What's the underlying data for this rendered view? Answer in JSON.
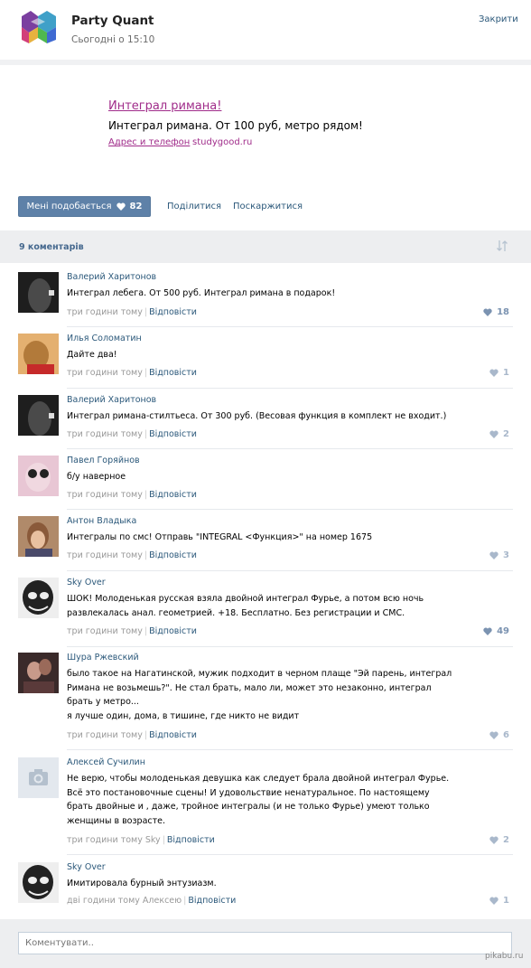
{
  "header": {
    "title": "Party Quant",
    "time": "Сьогодні о 15:10",
    "close": "Закрити"
  },
  "ad": {
    "title": "Интеграл римана!",
    "text": "Интеграл римана. От 100 руб, метро рядом!",
    "contacts": "Адрес и телефон",
    "site": "studygood.ru"
  },
  "actions": {
    "like_label": "Мені подобається",
    "like_count": "82",
    "share": "Поділитися",
    "report": "Поскаржитися"
  },
  "comments_header": {
    "count": "9 коментарів"
  },
  "comments": [
    {
      "author": "Валерий Харитонов",
      "text": "Интеграл лебега. От 500 руб. Интеграл римана в подарок!",
      "time": "три години тому",
      "reply": "Відповісти",
      "likes": "18",
      "avatar": "#2a2a2a"
    },
    {
      "author": "Илья Соломатин",
      "text": "Дайте два!",
      "time": "три години тому",
      "reply": "Відповісти",
      "likes": "1",
      "avatar": "#c98a3c"
    },
    {
      "author": "Валерий Харитонов",
      "text": "Интеграл римана-стилтьеса. От 300 руб. (Весовая функция в комплект не входит.)",
      "time": "три години тому",
      "reply": "Відповісти",
      "likes": "2",
      "avatar": "#2a2a2a"
    },
    {
      "author": "Павел Горяйнов",
      "text": "б/у наверное",
      "time": "три години тому",
      "reply": "Відповісти",
      "likes": "",
      "avatar": "#c9a6b8"
    },
    {
      "author": "Антон Владыка",
      "text": "Интегралы по смс! Отправь \"INTEGRAL <Функция>\" на номер 1675",
      "time": "три години тому",
      "reply": "Відповісти",
      "likes": "3",
      "avatar": "#8a6a52"
    },
    {
      "author": "Sky Over",
      "text": "ШОК! Молоденькая русская взяла двойной интеграл Фурье, а потом всю ночь развлекалась анал. геометрией. +18. Бесплатно. Без регистрации и СМС.",
      "time": "три години тому",
      "reply": "Відповісти",
      "likes": "49",
      "avatar": "#555555"
    },
    {
      "author": "Шура Ржевский",
      "text": "было такое на Нагатинской, мужик подходит в черном плаще \"Эй парень, интеграл Римана не возьмешь?\". Не стал брать, мало ли, может это незаконно, интеграл брать у метро...",
      "text2": "я лучше один, дома, в тишине, где никто не видит",
      "time": "три години тому",
      "reply": "Відповісти",
      "likes": "6",
      "avatar": "#6b4a4a"
    },
    {
      "author": "Алексей Сучилин",
      "text": "Не верю, чтобы молоденькая девушка как следует брала двойной интеграл Фурье. Всё это постановочные сцены! И удовольствие ненатуральное. По настоящему брать двойные и , даже, тройное интегралы (и не только Фурье) умеют только женщины в возрасте.",
      "time": "три години тому Sky",
      "reply": "Відповісти",
      "likes": "2",
      "avatar": "#e3e8ee"
    },
    {
      "author": "Sky Over",
      "text": "Имитировала бурный энтузиазм.",
      "time": "дві години тому Алексею",
      "reply": "Відповісти",
      "likes": "1",
      "avatar": "#555555"
    }
  ],
  "footer": {
    "placeholder": "Коментувати..",
    "watermark": "pikabu.ru"
  },
  "colors": {
    "link": "#2b587a",
    "ad_link": "#a02c8a",
    "button": "#5e81a8",
    "band": "#edeef0"
  }
}
